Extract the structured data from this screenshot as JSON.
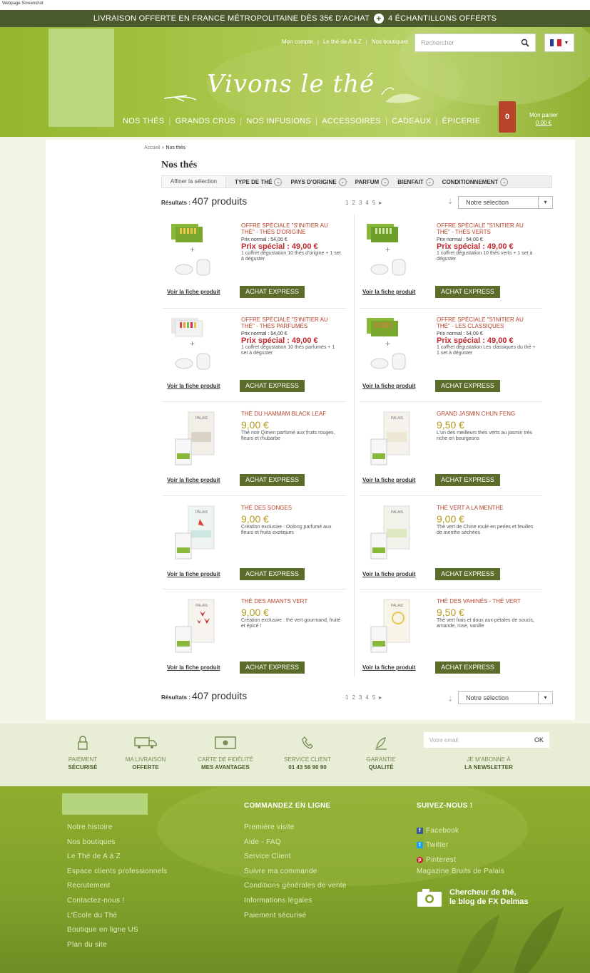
{
  "screenshot_label": "Webpage Screenshot",
  "promo": {
    "left": "LIVRAISON OFFERTE EN FRANCE MÉTROPOLITAINE DÈS 35€ D'ACHAT",
    "right": "4 ÉCHANTILLONS OFFERTS"
  },
  "header": {
    "links": [
      "Mon compte",
      "Le thé de A à Z",
      "Nos boutiques"
    ],
    "search_placeholder": "Rechercher",
    "tagline": "Vivons le thé",
    "nav": [
      "NOS THÉS",
      "GRANDS CRUS",
      "NOS INFUSIONS",
      "ACCESSOIRES",
      "CADEAUX",
      "ÉPICERIE"
    ],
    "cart_count": "0",
    "cart_label": "Mon panier",
    "cart_amount": "0,00 €"
  },
  "breadcrumb": {
    "home": "Accueil",
    "sep": "»",
    "current": "Nos thés"
  },
  "page_title": "Nos thés",
  "filters": {
    "refine": "Affiner la sélection",
    "items": [
      "TYPE DE THÉ",
      "PAYS D'ORIGINE",
      "PARFUM",
      "BIENFAIT",
      "CONDITIONNEMENT"
    ]
  },
  "results": {
    "label": "Résultats :",
    "count": "407 produits",
    "pages": [
      "1",
      "2",
      "3",
      "4",
      "5",
      "▸"
    ],
    "sort_value": "Notre sélection"
  },
  "products": [
    {
      "title": "OFFRE SPÉCIALE \"S'INITIER AU THÉ\" - THÉS D'ORIGINE",
      "normal": "Prix normal : 54,00 €",
      "special": "Prix spécial : 49,00 €",
      "desc": "1 coffret dégustation 10 thés d'origine + 1 set à déguster"
    },
    {
      "title": "OFFRE SPÉCIALE \"S'INITIER AU THÉ\" - THÉS VERTS",
      "normal": "Prix normal : 54,00 €",
      "special": "Prix spécial : 49,00 €",
      "desc": "1 coffret dégustation 10 thés verts + 1 set à déguster"
    },
    {
      "title": "OFFRE SPÉCIALE \"S'INITIER AU THÉ\" - THÉS PARFUMÉS",
      "normal": "Prix normal : 54,00 €",
      "special": "Prix spécial : 49,00 €",
      "desc": "1 coffret dégustation 10 thés parfumés + 1 set à déguster"
    },
    {
      "title": "OFFRE SPÉCIALE \"S'INITIER AU THÉ\" - LES CLASSIQUES",
      "normal": "Prix normal : 54,00 €",
      "special": "Prix spécial : 49,00 €",
      "desc": "1 coffret dégustation Les classiques du thé + 1 set à déguster"
    },
    {
      "title": "THÉ DU HAMMAM BLACK LEAF",
      "price": "9,00 €",
      "desc": "Thé noir Qimen parfumé aux fruits rouges, fleurs et rhubarbe"
    },
    {
      "title": "GRAND JASMIN CHUN FENG",
      "price": "9,50 €",
      "desc": "L'un des meilleurs thés verts au jasmin très riche en bourgeons"
    },
    {
      "title": "THÉ DES SONGES",
      "price": "9,00 €",
      "desc": "Création exclusive : Oolong parfumé aux fleurs et fruits exotiques"
    },
    {
      "title": "THÉ VERT A LA MENTHE",
      "price": "9,00 €",
      "desc": "Thé vert de Chine roulé en perles et feuilles de menthe séchées"
    },
    {
      "title": "THÉ DES AMANTS VERT",
      "price": "9,00 €",
      "desc": "Création exclusive : thé vert gourmand, fruité et épicé !"
    },
    {
      "title": "THÉ DES VAHINÉS - THÉ VERT",
      "price": "9,50 €",
      "desc": "Thé vert frais et doux aux pétales de soucis, amande, rose, vanille"
    }
  ],
  "card_actions": {
    "fiche": "Voir la fiche produit",
    "buy": "ACHAT EXPRESS"
  },
  "features": [
    {
      "l1": "PAIEMENT",
      "l2": "SÉCURISÉ",
      "icon": "lock-icon"
    },
    {
      "l1": "MA LIVRAISON",
      "l2": "OFFERTE",
      "icon": "truck-icon"
    },
    {
      "l1": "CARTE DE FIDÉLITÉ",
      "l2": "MES AVANTAGES",
      "icon": "card-icon"
    },
    {
      "l1": "SERVICE CLIENT",
      "l2": "01 43 56 90 90",
      "icon": "phone-icon"
    },
    {
      "l1": "GARANTIE",
      "l2": "QUALITÉ",
      "icon": "leaf-icon"
    }
  ],
  "newsletter": {
    "placeholder": "Votre email",
    "ok": "OK",
    "l1": "JE M'ABONNE À",
    "l2": "LA NEWSLETTER"
  },
  "footer": {
    "col1": [
      "Notre histoire",
      "Nos boutiques",
      "Le Thé de A à Z",
      "Espace clients professionnels",
      "Recrutement",
      "Contactez-nous !",
      "L'École du Thé",
      "Boutique en ligne US",
      "Plan du site"
    ],
    "col2_title": "COMMANDEZ EN LIGNE",
    "col2": [
      "Première visite",
      "Aide - FAQ",
      "Service Client",
      "Suivre ma commande",
      "Conditions générales de vente",
      "Informations légales",
      "Paiement sécurisé"
    ],
    "col3_title": "SUIVEZ-NOUS !",
    "social": [
      {
        "label": "Facebook",
        "color": "#3b5998",
        "glyph": "f"
      },
      {
        "label": "Twitter",
        "color": "#1da1f2",
        "glyph": "t"
      },
      {
        "label": "Pinterest",
        "color": "#cb2027",
        "glyph": "p"
      }
    ],
    "magazine": "Magazine Bruits de Palais",
    "blog_l1": "Chercheur de thé,",
    "blog_l2": "le blog de FX Delmas"
  },
  "colors": {
    "brand_green": "#8eaf30",
    "dark_green": "#5a6d2a",
    "accent_red": "#b8442c",
    "price_gold": "#b59a1e"
  }
}
